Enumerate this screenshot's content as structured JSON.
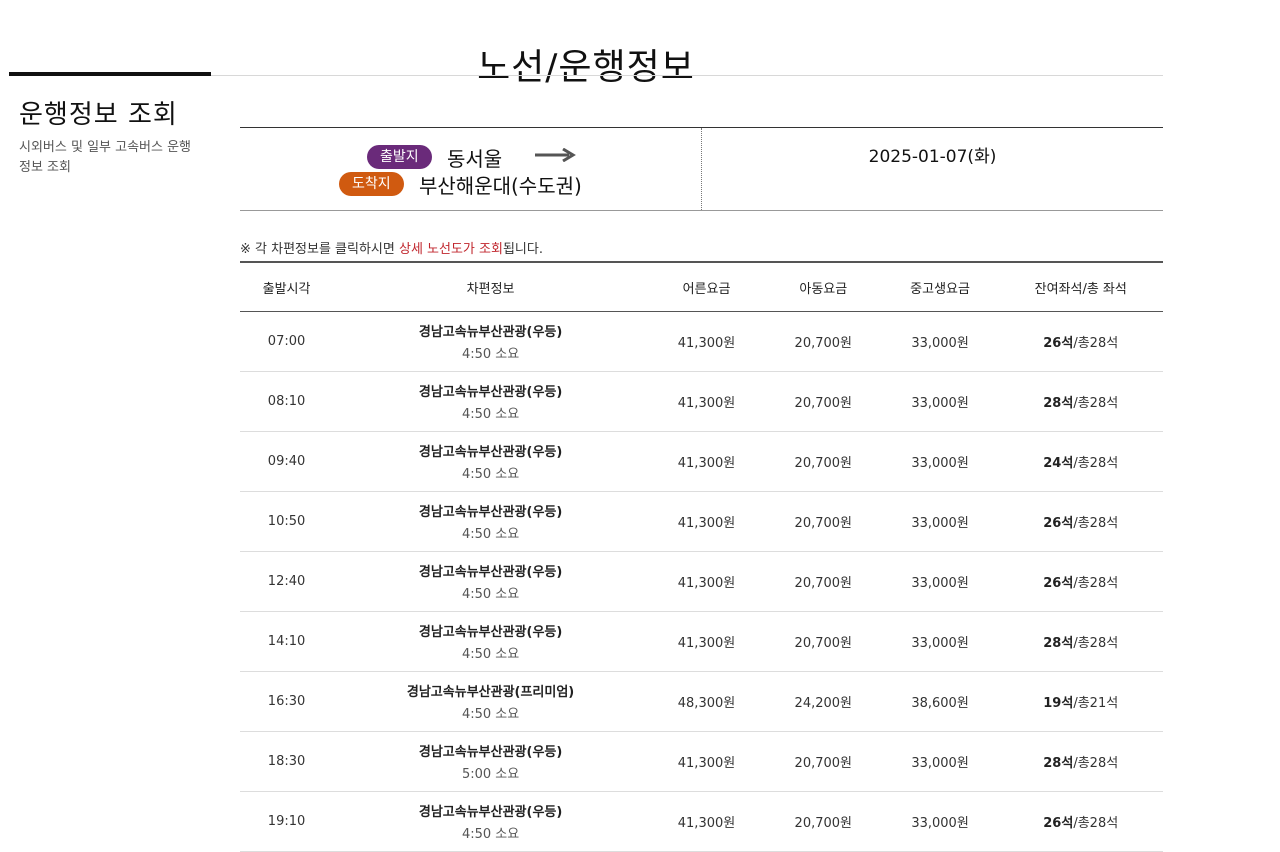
{
  "page": {
    "title": "노선/운행정보"
  },
  "sidebar": {
    "title": "운행정보 조회",
    "description": "시외버스 및 일부 고속버스 운행정보 조회"
  },
  "route": {
    "departure_badge": "출발지",
    "departure": "동서울",
    "arrival_badge": "도착지",
    "arrival": "부산해운대(수도권)",
    "date": "2025-01-07(화)"
  },
  "notice": {
    "prefix": "※ 각 차편정보를 클릭하시면 ",
    "highlight": "상세 노선도가 조회",
    "suffix": "됩니다."
  },
  "table": {
    "headers": [
      "출발시각",
      "차편정보",
      "어른요금",
      "아동요금",
      "중고생요금",
      "잔여좌석/총 좌석"
    ],
    "rows": [
      {
        "time": "07:00",
        "bus": "경남고속뉴부산관광(우등)",
        "duration": "4:50 소요",
        "adult": "41,300원",
        "child": "20,700원",
        "teen": "33,000원",
        "seats": "26석",
        "total": "/총28석"
      },
      {
        "time": "08:10",
        "bus": "경남고속뉴부산관광(우등)",
        "duration": "4:50 소요",
        "adult": "41,300원",
        "child": "20,700원",
        "teen": "33,000원",
        "seats": "28석",
        "total": "/총28석"
      },
      {
        "time": "09:40",
        "bus": "경남고속뉴부산관광(우등)",
        "duration": "4:50 소요",
        "adult": "41,300원",
        "child": "20,700원",
        "teen": "33,000원",
        "seats": "24석",
        "total": "/총28석"
      },
      {
        "time": "10:50",
        "bus": "경남고속뉴부산관광(우등)",
        "duration": "4:50 소요",
        "adult": "41,300원",
        "child": "20,700원",
        "teen": "33,000원",
        "seats": "26석",
        "total": "/총28석"
      },
      {
        "time": "12:40",
        "bus": "경남고속뉴부산관광(우등)",
        "duration": "4:50 소요",
        "adult": "41,300원",
        "child": "20,700원",
        "teen": "33,000원",
        "seats": "26석",
        "total": "/총28석"
      },
      {
        "time": "14:10",
        "bus": "경남고속뉴부산관광(우등)",
        "duration": "4:50 소요",
        "adult": "41,300원",
        "child": "20,700원",
        "teen": "33,000원",
        "seats": "28석",
        "total": "/총28석"
      },
      {
        "time": "16:30",
        "bus": "경남고속뉴부산관광(프리미엄)",
        "duration": "4:50 소요",
        "adult": "48,300원",
        "child": "24,200원",
        "teen": "38,600원",
        "seats": "19석",
        "total": "/총21석"
      },
      {
        "time": "18:30",
        "bus": "경남고속뉴부산관광(우등)",
        "duration": "5:00 소요",
        "adult": "41,300원",
        "child": "20,700원",
        "teen": "33,000원",
        "seats": "28석",
        "total": "/총28석"
      },
      {
        "time": "19:10",
        "bus": "경남고속뉴부산관광(우등)",
        "duration": "4:50 소요",
        "adult": "41,300원",
        "child": "20,700원",
        "teen": "33,000원",
        "seats": "26석",
        "total": "/총28석"
      }
    ]
  },
  "colors": {
    "departure_badge": "#6a2a7a",
    "arrival_badge": "#d05a10",
    "highlight": "#c0262d"
  },
  "icons": {
    "route_arrow": "arrow-right-icon"
  }
}
